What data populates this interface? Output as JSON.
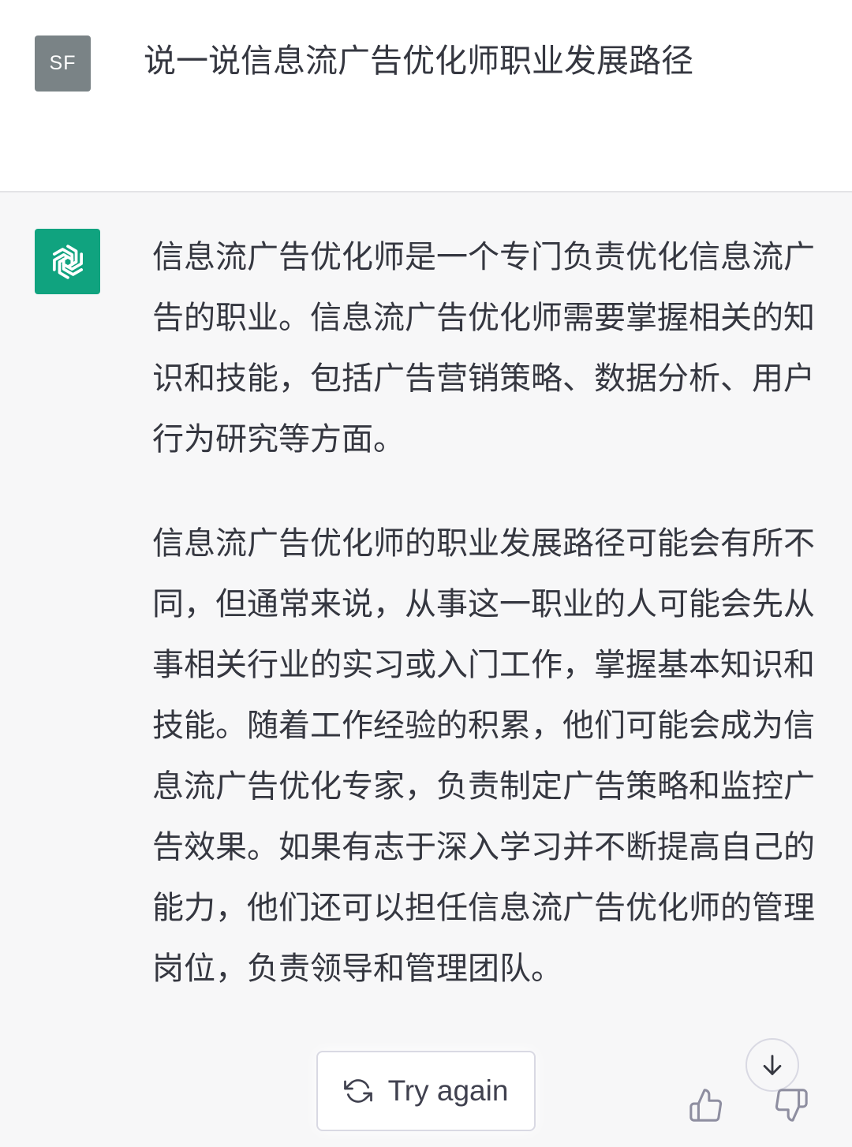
{
  "user_message": {
    "avatar_initials": "SF",
    "text": "说一说信息流广告优化师职业发展路径"
  },
  "assistant_message": {
    "avatar_icon": "openai-logo-icon",
    "paragraphs": [
      "信息流广告优化师是一个专门负责优化信息流广告的职业。信息流广告优化师需要掌握相关的知识和技能，包括广告营销策略、数据分析、用户行为研究等方面。",
      "信息流广告优化师的职业发展路径可能会有所不同，但通常来说，从事这一职业的人可能会先从事相关行业的实习或入门工作，掌握基本知识和技能。随着工作经验的积累，他们可能会成为信息流广告优化专家，负责制定广告策略和监控广告效果。如果有志于深入学习并不断提高自己的能力，他们还可以担任信息流广告优化师的管理岗位，负责领导和管理团队。"
    ]
  },
  "controls": {
    "try_again_label": "Try again",
    "try_again_icon": "refresh-icon",
    "scroll_down_icon": "arrow-down-icon",
    "thumbs_up_icon": "thumbs-up-icon",
    "thumbs_down_icon": "thumbs-down-icon"
  },
  "colors": {
    "user_avatar_bg": "#7a8386",
    "assistant_avatar_bg": "#10a37f",
    "assistant_row_bg": "#f7f7f8",
    "text": "#353740"
  }
}
